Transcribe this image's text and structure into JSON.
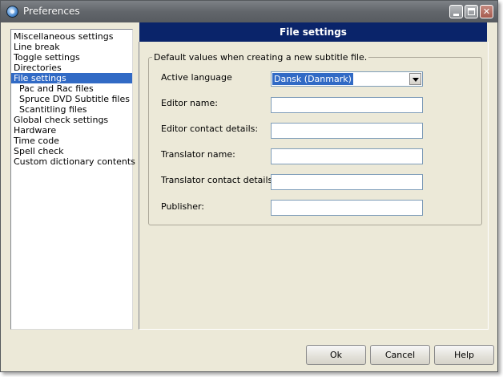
{
  "window": {
    "title": "Preferences"
  },
  "sidebar": {
    "items": [
      {
        "label": "Miscellaneous settings",
        "level": 0,
        "selected": false
      },
      {
        "label": "Line break",
        "level": 0,
        "selected": false
      },
      {
        "label": "Toggle settings",
        "level": 0,
        "selected": false
      },
      {
        "label": "Directories",
        "level": 0,
        "selected": false
      },
      {
        "label": "File settings",
        "level": 0,
        "selected": true
      },
      {
        "label": "Pac and Rac files",
        "level": 1,
        "selected": false
      },
      {
        "label": "Spruce DVD Subtitle files",
        "level": 1,
        "selected": false
      },
      {
        "label": "Scantitling files",
        "level": 1,
        "selected": false
      },
      {
        "label": "Global check settings",
        "level": 0,
        "selected": false
      },
      {
        "label": "Hardware",
        "level": 0,
        "selected": false
      },
      {
        "label": "Time code",
        "level": 0,
        "selected": false
      },
      {
        "label": "Spell check",
        "level": 0,
        "selected": false
      },
      {
        "label": "Custom dictionary contents",
        "level": 0,
        "selected": false
      }
    ]
  },
  "panel": {
    "title": "File settings",
    "group_label": "Default values when creating a new subtitle file.",
    "fields": {
      "active_language": {
        "label": "Active language",
        "value": "Dansk (Danmark)"
      },
      "editor_name": {
        "label": "Editor name:",
        "value": ""
      },
      "editor_contact": {
        "label": "Editor contact details:",
        "value": ""
      },
      "translator_name": {
        "label": "Translator name:",
        "value": ""
      },
      "translator_contact": {
        "label": "Translator contact details:",
        "value": ""
      },
      "publisher": {
        "label": "Publisher:",
        "value": ""
      }
    }
  },
  "buttons": {
    "ok": "Ok",
    "cancel": "Cancel",
    "help": "Help"
  },
  "colors": {
    "header_bg": "#0a246a",
    "selection": "#316ac5",
    "dialog_bg": "#ece9d8"
  }
}
